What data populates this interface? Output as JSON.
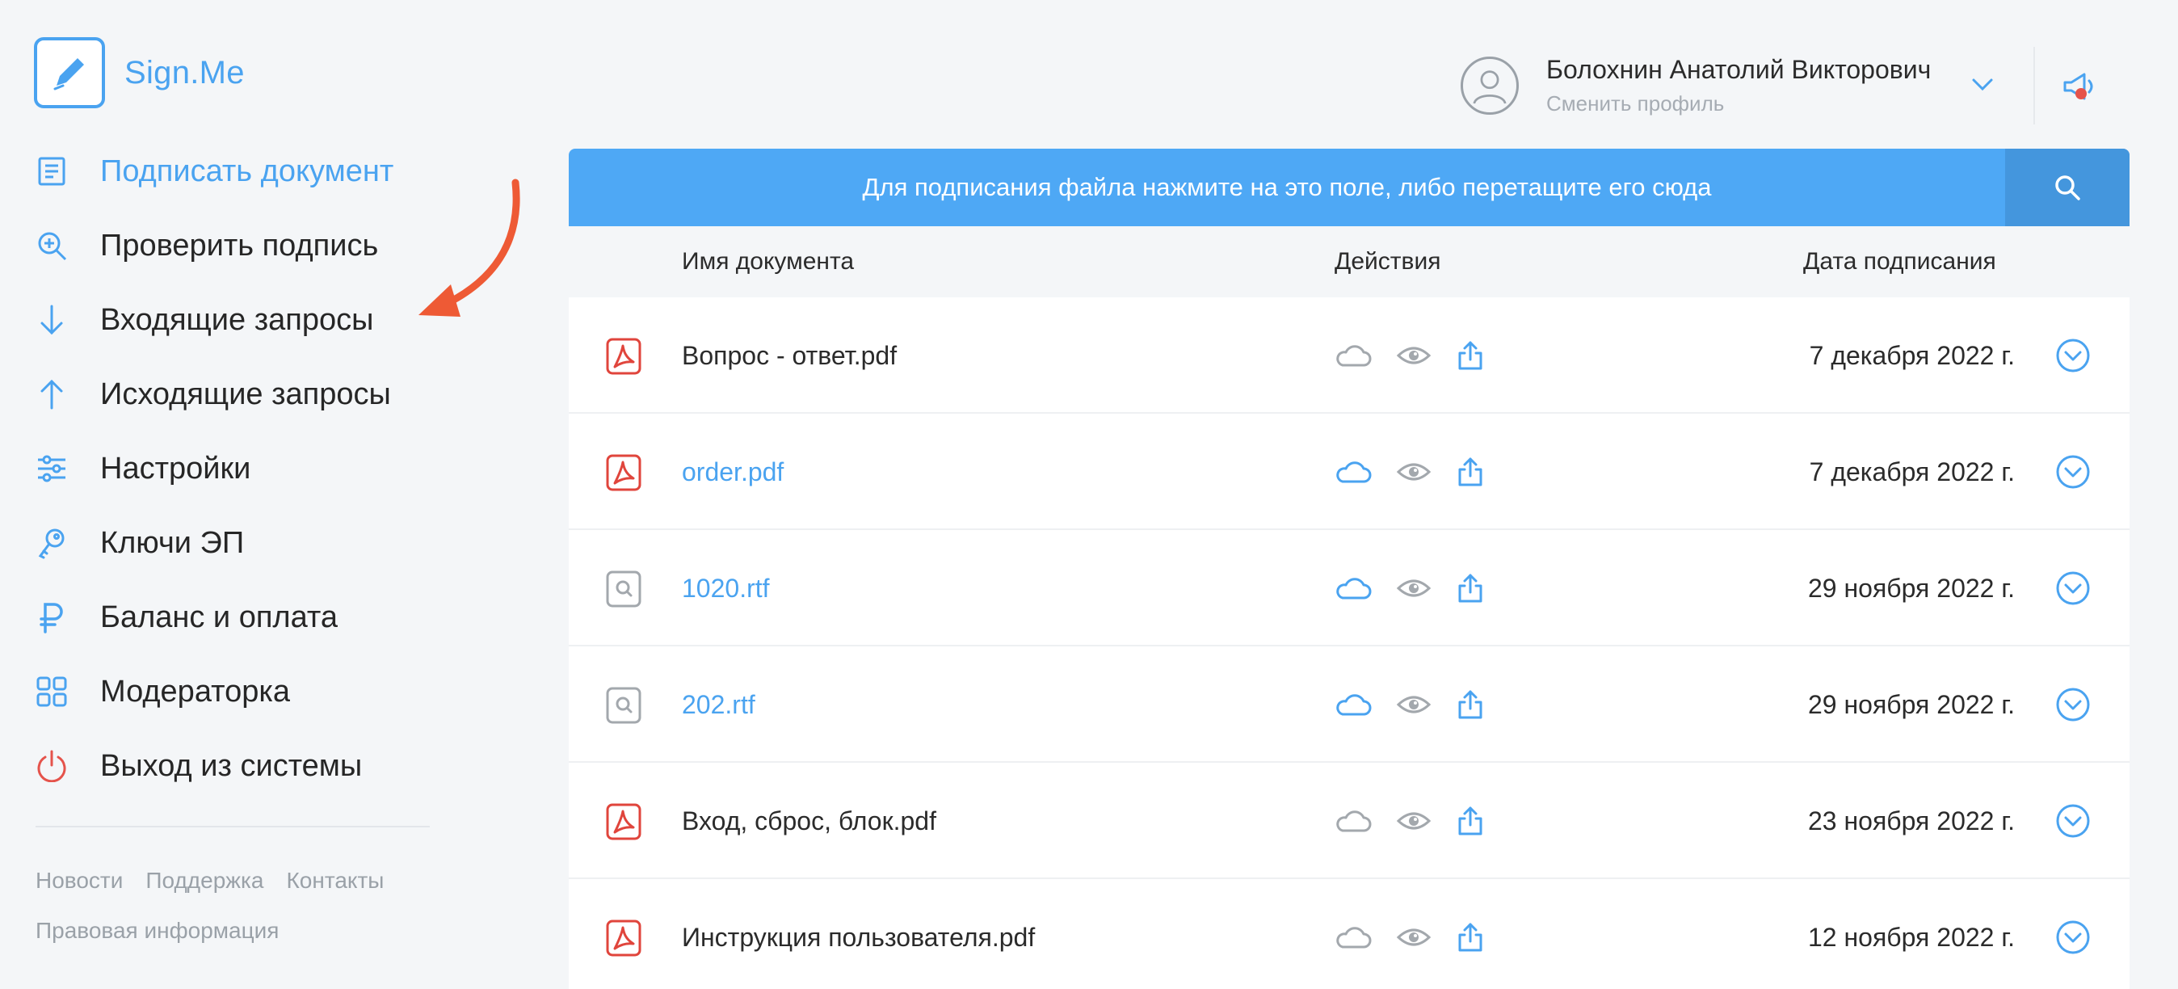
{
  "app": {
    "name": "Sign.Me",
    "accent_color": "#4aa3f0",
    "danger_color": "#e5534b",
    "pdf_icon_color": "#e0453c"
  },
  "sidebar": {
    "items": [
      {
        "label": "Подписать документ",
        "icon": "document-sign-icon",
        "active": true
      },
      {
        "label": "Проверить подпись",
        "icon": "verify-zoom-icon"
      },
      {
        "label": "Входящие запросы",
        "icon": "arrow-down-icon"
      },
      {
        "label": "Исходящие запросы",
        "icon": "arrow-up-icon"
      },
      {
        "label": "Настройки",
        "icon": "sliders-icon"
      },
      {
        "label": "Ключи ЭП",
        "icon": "key-icon"
      },
      {
        "label": "Баланс и оплата",
        "icon": "ruble-icon"
      },
      {
        "label": "Модераторка",
        "icon": "grid-icon"
      },
      {
        "label": "Выход из системы",
        "icon": "power-icon"
      }
    ],
    "footer_links": [
      "Новости",
      "Поддержка",
      "Контакты",
      "Правовая информация"
    ]
  },
  "header": {
    "user_name": "Болохнин Анатолий Викторович",
    "switch_profile": "Сменить профиль",
    "notification_badge_color": "#e5534b"
  },
  "upload": {
    "prompt": "Для подписания файла нажмите на это поле, либо перетащите его сюда"
  },
  "table": {
    "headers": {
      "name": "Имя документа",
      "actions": "Действия",
      "date": "Дата подписания"
    },
    "rows": [
      {
        "name": "Вопрос - ответ.pdf",
        "type": "pdf",
        "is_link": false,
        "cloud_active": false,
        "date": "7 декабря 2022 г."
      },
      {
        "name": "order.pdf",
        "type": "pdf",
        "is_link": true,
        "cloud_active": true,
        "date": "7 декабря 2022 г."
      },
      {
        "name": "1020.rtf",
        "type": "rtf",
        "is_link": true,
        "cloud_active": true,
        "date": "29 ноября 2022 г."
      },
      {
        "name": "202.rtf",
        "type": "rtf",
        "is_link": true,
        "cloud_active": true,
        "date": "29 ноября 2022 г."
      },
      {
        "name": "Вход, сброс, блок.pdf",
        "type": "pdf",
        "is_link": false,
        "cloud_active": false,
        "date": "23 ноября 2022 г."
      },
      {
        "name": "Инструкция пользователя.pdf",
        "type": "pdf",
        "is_link": false,
        "cloud_active": false,
        "date": "12 ноября 2022 г."
      }
    ]
  }
}
